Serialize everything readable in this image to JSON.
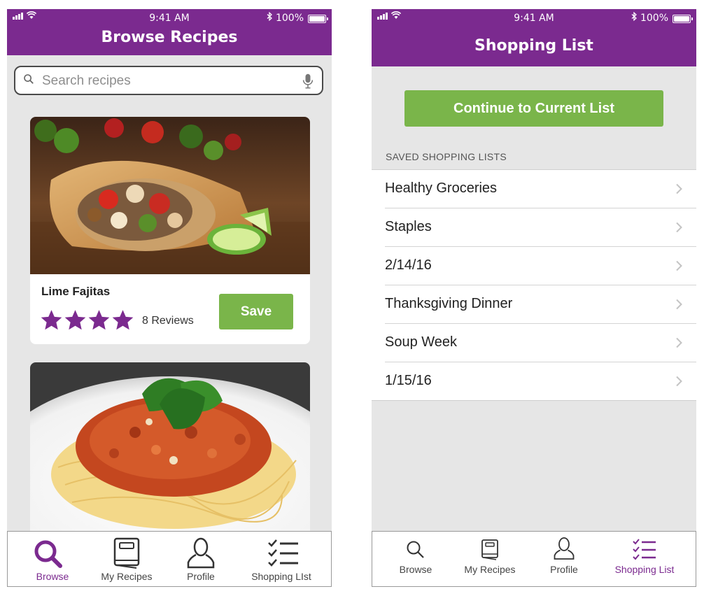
{
  "status_bar": {
    "time": "9:41 AM",
    "battery": "100%"
  },
  "browse_screen": {
    "title": "Browse Recipes",
    "search": {
      "placeholder": "Search recipes",
      "value": ""
    },
    "recipes": [
      {
        "name": "Lime Fajitas",
        "rating": 4,
        "reviews": "8 Reviews",
        "save_label": "Save"
      },
      {
        "name": ""
      }
    ],
    "tab_bar": {
      "items": [
        {
          "label": "Browse",
          "icon": "search-icon",
          "active": true
        },
        {
          "label": "My Recipes",
          "icon": "book-icon",
          "active": false
        },
        {
          "label": "Profile",
          "icon": "person-icon",
          "active": false
        },
        {
          "label": "Shopping LIst",
          "icon": "checklist-icon",
          "active": false
        }
      ]
    }
  },
  "shopping_screen": {
    "title": "Shopping List",
    "continue_label": "Continue to Current List",
    "section_header": "SAVED SHOPPING LISTS",
    "lists": [
      {
        "label": "Healthy Groceries"
      },
      {
        "label": "Staples"
      },
      {
        "label": "2/14/16"
      },
      {
        "label": "Thanksgiving Dinner"
      },
      {
        "label": "Soup Week"
      },
      {
        "label": "1/15/16"
      }
    ],
    "tab_bar": {
      "items": [
        {
          "label": "Browse",
          "icon": "search-icon",
          "active": false
        },
        {
          "label": "My Recipes",
          "icon": "book-icon",
          "active": false
        },
        {
          "label": "Profile",
          "icon": "person-icon",
          "active": false
        },
        {
          "label": "Shopping List",
          "icon": "checklist-icon",
          "active": true
        }
      ]
    }
  },
  "colors": {
    "brand_purple": "#7b2a8f",
    "accent_green": "#7ab54a",
    "background_gray": "#e6e6e6"
  }
}
